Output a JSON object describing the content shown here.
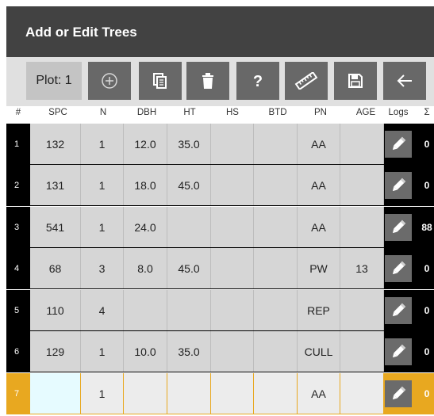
{
  "app": {
    "title": "Add or Edit Trees"
  },
  "toolbar": {
    "plot_label": "Plot: 1",
    "buttons": [
      {
        "name": "add-tree-button",
        "icon": "add-circle-icon"
      },
      {
        "name": "copy-tree-button",
        "icon": "copy-icon"
      },
      {
        "name": "delete-tree-button",
        "icon": "trash-icon"
      },
      {
        "name": "help-button",
        "icon": "help-question-icon"
      },
      {
        "name": "measure-button",
        "icon": "ruler-icon"
      },
      {
        "name": "save-button",
        "icon": "save-disk-icon"
      },
      {
        "name": "back-button",
        "icon": "back-arrow-icon"
      }
    ]
  },
  "columns": [
    "#",
    "SPC",
    "N",
    "DBH",
    "HT",
    "HS",
    "BTD",
    "PN",
    "AGE",
    "Logs",
    "Σ"
  ],
  "rows": [
    {
      "num": "1",
      "spc": "132",
      "n": "1",
      "dbh": "12.0",
      "ht": "35.0",
      "hs": "",
      "btd": "",
      "pn": "AA",
      "age": "",
      "sigma": "0"
    },
    {
      "num": "2",
      "spc": "131",
      "n": "1",
      "dbh": "18.0",
      "ht": "45.0",
      "hs": "",
      "btd": "",
      "pn": "AA",
      "age": "",
      "sigma": "0"
    },
    {
      "num": "3",
      "spc": "541",
      "n": "1",
      "dbh": "24.0",
      "ht": "",
      "hs": "",
      "btd": "",
      "pn": "AA",
      "age": "",
      "sigma": "88"
    },
    {
      "num": "4",
      "spc": "68",
      "n": "3",
      "dbh": "8.0",
      "ht": "45.0",
      "hs": "",
      "btd": "",
      "pn": "PW",
      "age": "13",
      "sigma": "0"
    },
    {
      "num": "5",
      "spc": "110",
      "n": "4",
      "dbh": "",
      "ht": "",
      "hs": "",
      "btd": "",
      "pn": "REP",
      "age": "",
      "sigma": "0"
    },
    {
      "num": "6",
      "spc": "129",
      "n": "1",
      "dbh": "10.0",
      "ht": "35.0",
      "hs": "",
      "btd": "",
      "pn": "CULL",
      "age": "",
      "sigma": "0"
    },
    {
      "num": "7",
      "spc": "",
      "n": "1",
      "dbh": "",
      "ht": "",
      "hs": "",
      "btd": "",
      "pn": "AA",
      "age": "",
      "sigma": "0"
    }
  ],
  "colors": {
    "titlebar": "#424242",
    "selected_row": "#e8a820",
    "cell": "#d6d6d6",
    "button": "#686868"
  }
}
